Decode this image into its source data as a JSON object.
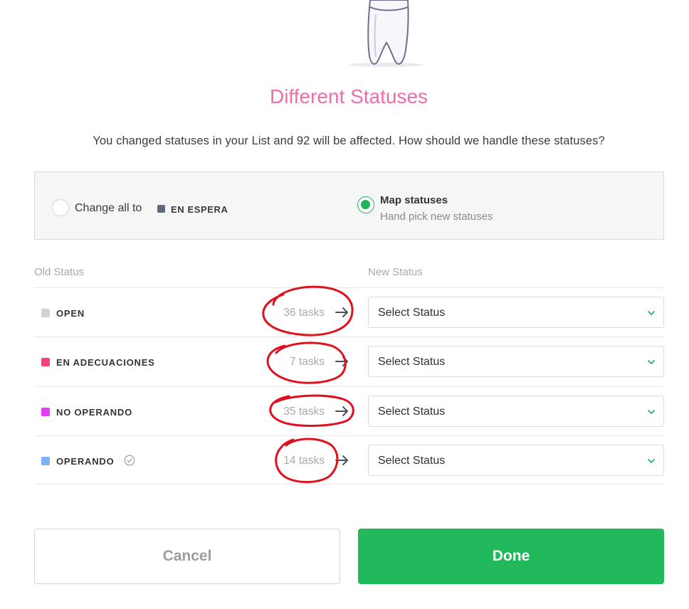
{
  "dialog": {
    "title": "Different Statuses",
    "message": "You changed statuses in your List and 92 will be affected. How should we handle these statuses?"
  },
  "options": {
    "change_all": {
      "label": "Change all to",
      "status": "EN ESPERA",
      "status_color": "#5e6a79",
      "selected": false
    },
    "map": {
      "label": "Map statuses",
      "sublabel": "Hand pick new statuses",
      "selected": true
    }
  },
  "columns": {
    "old": "Old Status",
    "new": "New Status"
  },
  "rows": [
    {
      "name": "OPEN",
      "color": "#d3d3d3",
      "count": "36 tasks",
      "select": "Select Status",
      "closed": false
    },
    {
      "name": "EN ADECUACIONES",
      "color": "#f5417a",
      "count": "7 tasks",
      "select": "Select Status",
      "closed": false
    },
    {
      "name": "NO OPERANDO",
      "color": "#e23ef0",
      "count": "35 tasks",
      "select": "Select Status",
      "closed": false
    },
    {
      "name": "OPERANDO",
      "color": "#7eb0f4",
      "count": "14 tasks",
      "select": "Select Status",
      "closed": true
    }
  ],
  "buttons": {
    "cancel": "Cancel",
    "done": "Done"
  },
  "colors": {
    "accent": "#21b95b",
    "title": "#f06ea9",
    "annotation": "#e0111f"
  }
}
